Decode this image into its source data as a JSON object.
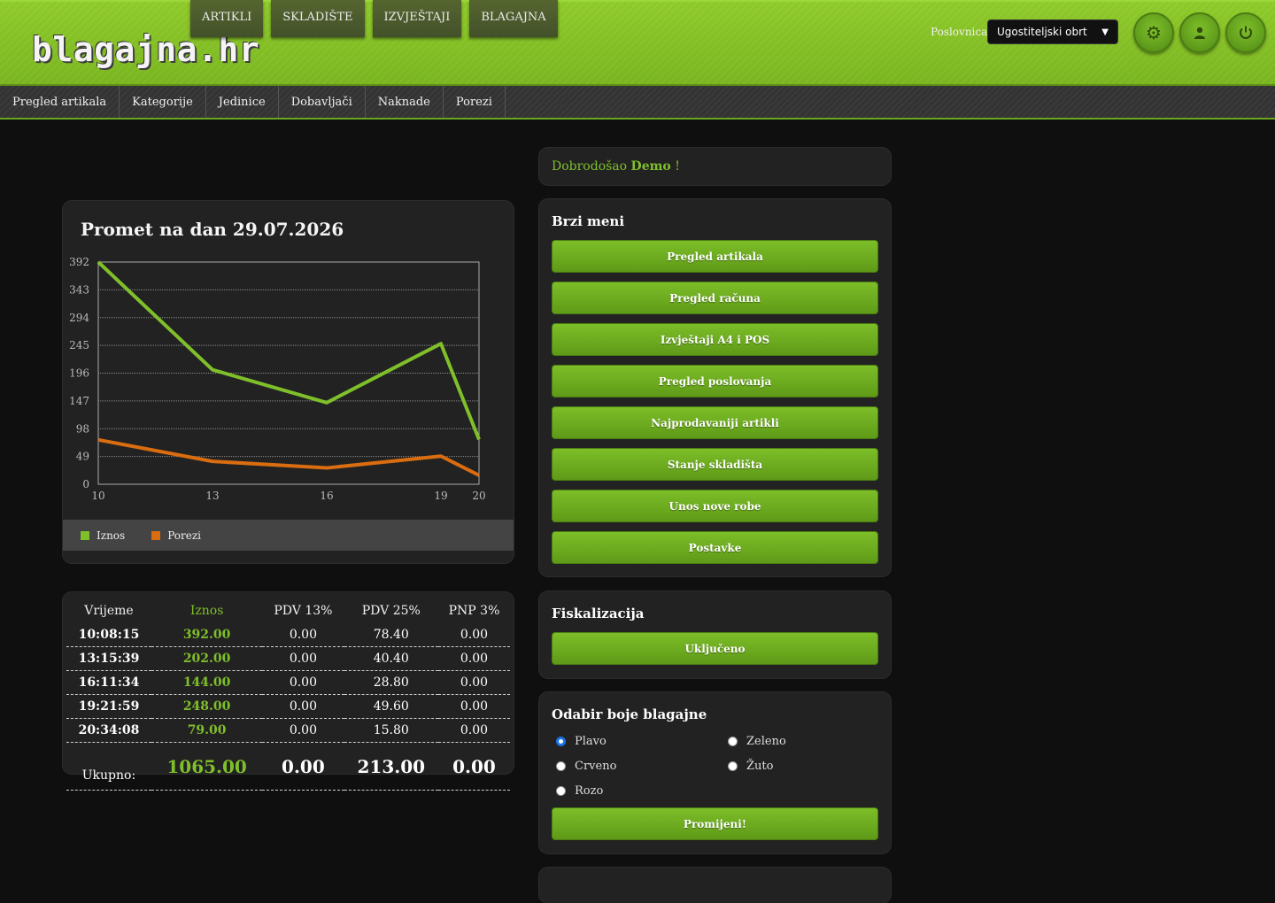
{
  "header": {
    "logo": "blagajna.hr",
    "nav": [
      "ARTIKLI",
      "SKLADIŠTE",
      "IZVJEŠTAJI",
      "BLAGAJNA"
    ],
    "poslovnica_label": "Poslovnica:",
    "poslovnica_value": "Ugostiteljski obrt"
  },
  "subnav": [
    "Pregled artikala",
    "Kategorije",
    "Jedinice",
    "Dobavljači",
    "Naknade",
    "Porezi"
  ],
  "chart": {
    "title": "Promet na dan 29.07.2026",
    "legend": [
      "Iznos",
      "Porezi"
    ]
  },
  "chart_data": {
    "type": "line",
    "x": [
      10,
      13,
      16,
      19,
      20
    ],
    "x_ticks": [
      "10",
      "13",
      "16",
      "19",
      "20"
    ],
    "y_ticks": [
      "0",
      "49",
      "98",
      "147",
      "196",
      "245",
      "294",
      "343",
      "392"
    ],
    "ylim": [
      0,
      392
    ],
    "series": [
      {
        "name": "Iznos",
        "color": "#7fbf2a",
        "values": [
          392,
          202,
          144,
          248,
          79
        ]
      },
      {
        "name": "Porezi",
        "color": "#d96d10",
        "values": [
          78.4,
          40.4,
          28.8,
          49.6,
          15.8
        ]
      }
    ]
  },
  "table": {
    "headers": [
      "Vrijeme",
      "Iznos",
      "PDV 13%",
      "PDV 25%",
      "PNP 3%"
    ],
    "rows": [
      [
        "10:08:15",
        "392.00",
        "0.00",
        "78.40",
        "0.00"
      ],
      [
        "13:15:39",
        "202.00",
        "0.00",
        "40.40",
        "0.00"
      ],
      [
        "16:11:34",
        "144.00",
        "0.00",
        "28.80",
        "0.00"
      ],
      [
        "19:21:59",
        "248.00",
        "0.00",
        "49.60",
        "0.00"
      ],
      [
        "20:34:08",
        "79.00",
        "0.00",
        "15.80",
        "0.00"
      ]
    ],
    "total": [
      "Ukupno:",
      "1065.00",
      "0.00",
      "213.00",
      "0.00"
    ]
  },
  "welcome": {
    "prefix": "Dobrodošao",
    "user": "Demo",
    "suffix": "!"
  },
  "quick_menu": {
    "title": "Brzi meni",
    "buttons": [
      "Pregled artikala",
      "Pregled računa",
      "Izvještaji A4 i POS",
      "Pregled poslovanja",
      "Najprodavaniji artikli",
      "Stanje skladišta",
      "Unos nove robe",
      "Postavke"
    ]
  },
  "fiscal": {
    "title": "Fiskalizacija",
    "button": "Uključeno"
  },
  "color_choice": {
    "title": "Odabir boje blagajne",
    "options": [
      "Plavo",
      "Zeleno",
      "Crveno",
      "Žuto",
      "Rozo"
    ],
    "selected": "Plavo",
    "button": "Promijeni!"
  },
  "colors": {
    "accent": "#7fbf2a",
    "tax": "#d96d10"
  },
  "icons": {
    "settings": "gear-icon",
    "user": "user-icon",
    "logout": "power-icon"
  }
}
